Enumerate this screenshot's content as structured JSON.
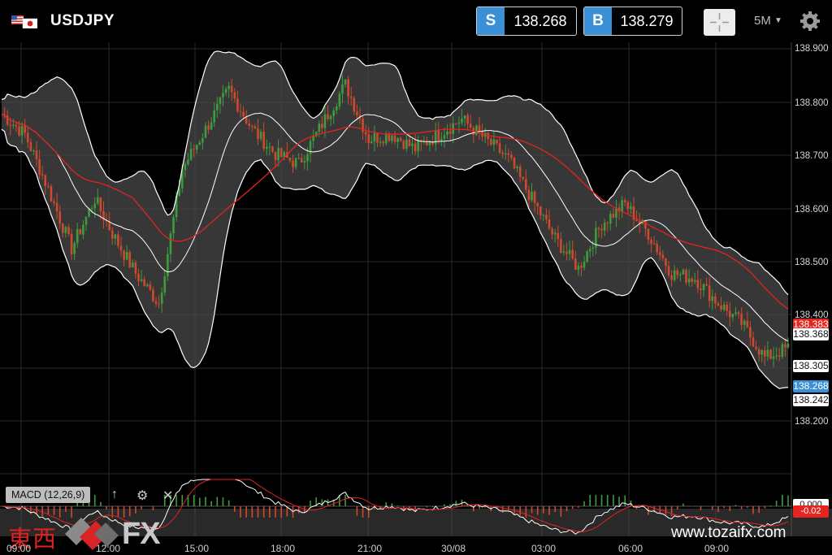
{
  "header": {
    "symbol": "USDJPY",
    "sell": {
      "tag": "S",
      "price": "138.268"
    },
    "buy": {
      "tag": "B",
      "price": "138.279"
    },
    "timeframe": "5M",
    "crosshair_icon": "crosshair-icon",
    "settings_icon": "gear-icon"
  },
  "price_axis": {
    "labels": [
      "138.900",
      "138.800",
      "138.700",
      "138.600",
      "138.500",
      "138.400",
      "138.300",
      "138.200"
    ],
    "tags": {
      "ma": "138.383",
      "upper_band": "138.368",
      "last": "138.305",
      "sell": "138.268",
      "lower_band": "138.242"
    }
  },
  "macd": {
    "label": "MACD (12,26,9)",
    "value_tag": "0.000",
    "signal_tag": "-0.02",
    "up_icon": "arrow-up-icon",
    "settings_icon": "gear-icon",
    "close_icon": "close-icon"
  },
  "time_axis": [
    "09:00",
    "12:00",
    "15:00",
    "18:00",
    "21:00",
    "30/08",
    "03:00",
    "06:00",
    "09:00"
  ],
  "watermark": {
    "kanji": "東西",
    "fx": "FX",
    "website": "www.tozaifx.com"
  },
  "chart_data": {
    "type": "candlestick",
    "symbol": "USDJPY",
    "timeframe": "5M",
    "ylim": [
      138.15,
      138.9
    ],
    "indicators": [
      "Bollinger Bands",
      "Moving Average",
      "MACD (12,26,9)"
    ],
    "close_path": [
      [
        0,
        138.77
      ],
      [
        8,
        138.73
      ],
      [
        16,
        138.62
      ],
      [
        24,
        138.5
      ],
      [
        32,
        138.6
      ],
      [
        38,
        138.53
      ],
      [
        46,
        138.45
      ],
      [
        54,
        138.39
      ],
      [
        62,
        138.66
      ],
      [
        70,
        138.74
      ],
      [
        78,
        138.82
      ],
      [
        86,
        138.74
      ],
      [
        94,
        138.69
      ],
      [
        102,
        138.67
      ],
      [
        110,
        138.75
      ],
      [
        118,
        138.83
      ],
      [
        126,
        138.72
      ],
      [
        134,
        138.73
      ],
      [
        142,
        138.7
      ],
      [
        150,
        138.73
      ],
      [
        158,
        138.76
      ],
      [
        166,
        138.72
      ],
      [
        174,
        138.68
      ],
      [
        182,
        138.6
      ],
      [
        190,
        138.52
      ],
      [
        198,
        138.46
      ],
      [
        206,
        138.55
      ],
      [
        214,
        138.59
      ],
      [
        222,
        138.53
      ],
      [
        230,
        138.45
      ],
      [
        238,
        138.44
      ],
      [
        246,
        138.39
      ],
      [
        254,
        138.35
      ],
      [
        262,
        138.28
      ],
      [
        270,
        138.3
      ]
    ]
  },
  "colors": {
    "bull": "#3f9b3f",
    "bear": "#cf4a2d",
    "band": "#ffffff",
    "ma": "#e52222",
    "quote_tag": "#3a8fd6",
    "ma_tag": "#e3261f"
  }
}
